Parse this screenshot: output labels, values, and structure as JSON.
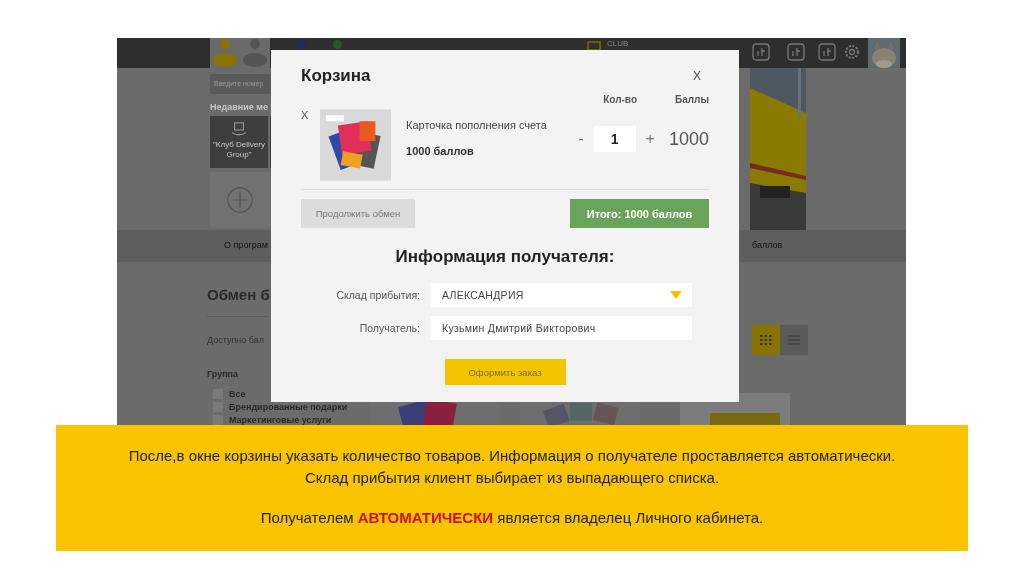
{
  "backdrop": {
    "club_label": "CLUB",
    "search_placeholder": "Введите номер",
    "recent_heading": "Недавние ме",
    "recent_tile": "\"Клуб Delivery Group\"",
    "nav": [
      "О програм",
      "баллов"
    ],
    "section_title": "Обмен б",
    "balance_label": "Доступно бал",
    "group_heading": "Группа",
    "groups": [
      {
        "label": "Все",
        "checked": false
      },
      {
        "label": "Брендированные подарки",
        "checked": false
      },
      {
        "label": "Маркетинговые услуги",
        "checked": false
      }
    ],
    "view_toggle": [
      {
        "kind": "grid",
        "selected": true
      },
      {
        "kind": "list",
        "selected": false
      }
    ]
  },
  "cart": {
    "title": "Корзина",
    "close": "X",
    "columns": [
      "Кол-во",
      "Баллы"
    ],
    "items": [
      {
        "remove": "X",
        "name": "Карточка пополнения счета",
        "price": "1000 баллов",
        "minus": "-",
        "quantity": "1",
        "plus": "+",
        "points": "1000"
      }
    ],
    "continue_button": "Продолжить обмен",
    "total_button": "Итого: 1000 баллов",
    "recipient": {
      "heading": "Информация получателя:",
      "fields": [
        {
          "kind": "select",
          "label": "Склад прибытия:",
          "value": "АЛЕКСАНДРИЯ"
        },
        {
          "kind": "text",
          "label": "Получатель:",
          "value": "Кузьмин Дмитрий Викторович"
        }
      ],
      "submit": "Оформить заказ"
    }
  },
  "note": {
    "lines": [
      "После,в окне корзины указать количество товаров. Информация о получателе проставляется автоматически.",
      "Склад прибытия  клиент выбирает из выпадающего списка."
    ],
    "emphasis": "Получателем **АВТОМАТИЧЕСКИ** является владелец Личного кабинета."
  }
}
